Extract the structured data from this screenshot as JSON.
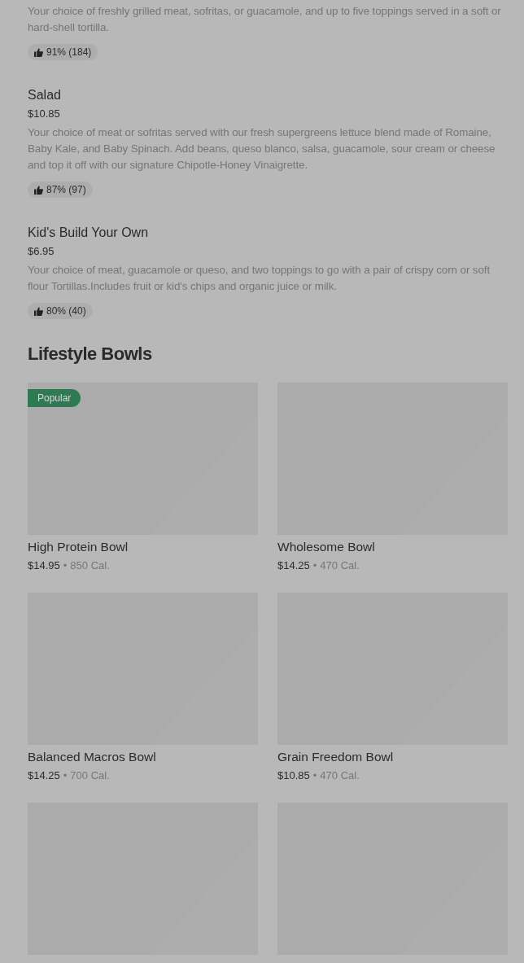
{
  "menu_items": [
    {
      "description": "Your choice of freshly grilled meat, sofritas, or guacamole, and up to five toppings served in a soft or hard-shell tortilla.",
      "rating": "91% (184)"
    },
    {
      "name": "Salad",
      "price": "$10.85",
      "description": "Your choice of meat or sofritas served with our fresh supergreens lettuce blend made of Romaine, Baby Kale, and Baby Spinach. Add beans, queso blanco, salsa, guacamole, sour cream or cheese and top it off with our signature Chipotle-Honey Vinaigrette.",
      "rating": "87% (97)"
    },
    {
      "name": "Kid's Build Your Own",
      "price": "$6.95",
      "description": "Your choice of meat, guacamole or queso, and two toppings to go with a pair of crispy corn or soft flour Tortillas.Includes fruit or kid's chips and organic juice or milk.",
      "rating": "80% (40)"
    }
  ],
  "section": {
    "title": "Lifestyle Bowls",
    "cards": [
      {
        "kind": "dish",
        "badge": "Popular",
        "name": "High Protein Bowl",
        "price": "$14.95",
        "separator": "•",
        "calories": "850 Cal."
      },
      {
        "kind": "dish",
        "name": "Wholesome Bowl",
        "price": "$14.25",
        "separator": "•",
        "calories": "470 Cal."
      },
      {
        "kind": "dish",
        "name": "Balanced Macros Bowl",
        "price": "$14.25",
        "separator": "•",
        "calories": "700 Cal."
      },
      {
        "kind": "dish",
        "name": "Grain Freedom Bowl",
        "price": "$10.85",
        "separator": "•",
        "calories": "470 Cal."
      },
      {
        "kind": "image_only"
      },
      {
        "kind": "image_only"
      }
    ]
  }
}
